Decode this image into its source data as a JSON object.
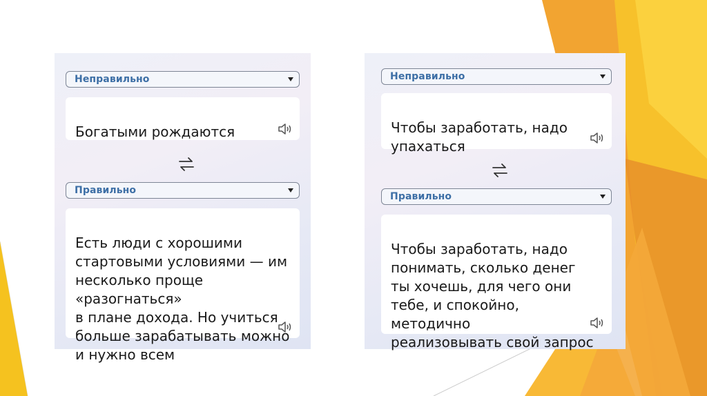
{
  "colors": {
    "accent_label": "#3d6fa6",
    "background_decoration": [
      "#f5a623",
      "#f7c12b",
      "#e8902a",
      "#fbd340"
    ]
  },
  "cards": [
    {
      "source_language": "Неправильно",
      "source_text": "Богатыми рождаются",
      "target_language": "Правильно",
      "target_text": "Есть люди с хорошими\nстартовыми условиями — им\nнесколько проще «разогнаться»\nв плане дохода. Но учиться\nбольше зарабатывать можно\nи нужно всем",
      "icons": [
        "chevron-down-icon",
        "speaker-icon",
        "swap-icon"
      ]
    },
    {
      "source_language": "Неправильно",
      "source_text": "Чтобы заработать, надо\nупахаться",
      "target_language": "Правильно",
      "target_text": "Чтобы заработать, надо\nпонимать, сколько денег\nты хочешь, для чего они\nтебе, и спокойно, методично\nреализовывать свой запрос",
      "icons": [
        "chevron-down-icon",
        "speaker-icon",
        "swap-icon"
      ]
    }
  ]
}
